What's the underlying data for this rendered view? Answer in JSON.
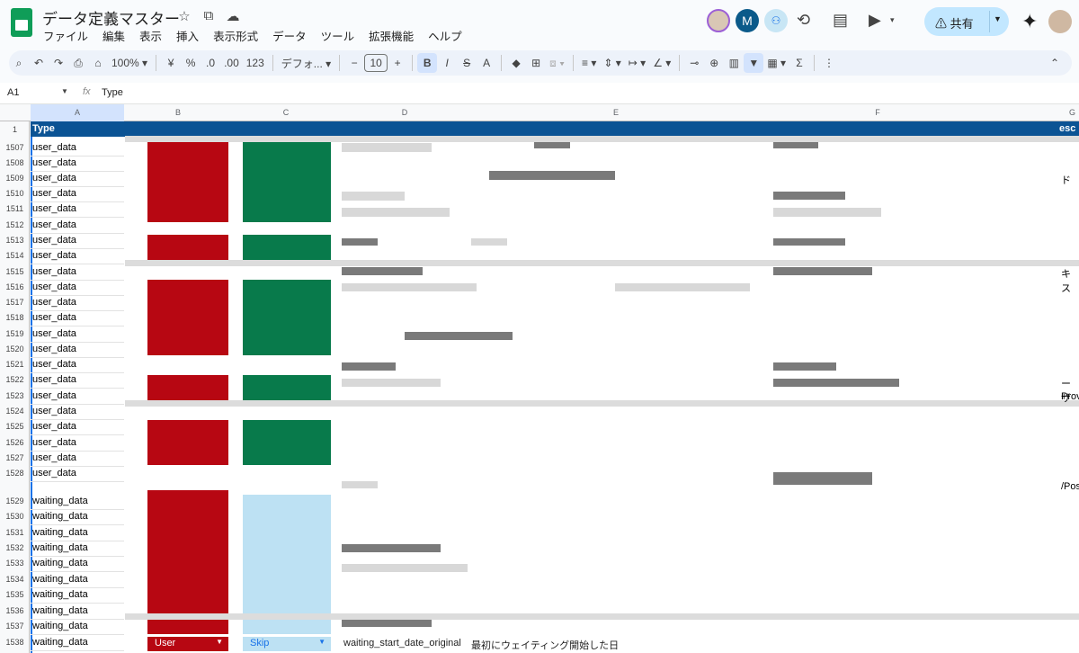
{
  "document": {
    "title": "データ定義マスター"
  },
  "menu": [
    "ファイル",
    "編集",
    "表示",
    "挿入",
    "表示形式",
    "データ",
    "ツール",
    "拡張機能",
    "ヘルプ"
  ],
  "header": {
    "share_label": "共有",
    "avatar_initial": "M"
  },
  "toolbar": {
    "zoom": "100%",
    "currency": "¥",
    "percent": "%",
    "dec_minus": ".0",
    "dec_plus": ".00",
    "number_format": "123",
    "font": "デフォ...",
    "font_size": "10",
    "bold": "B",
    "italic": "I",
    "strike": "S",
    "text_color": "A",
    "sum": "Σ"
  },
  "formula": {
    "cell": "A1",
    "fx": "fx",
    "value": "Type"
  },
  "columns": [
    "A",
    "B",
    "C",
    "D",
    "E",
    "F",
    "G"
  ],
  "sheet": {
    "header_type": "Type",
    "header_g": "esc",
    "rows": [
      {
        "num": "1507",
        "type": "user_data"
      },
      {
        "num": "1508",
        "type": "user_data"
      },
      {
        "num": "1509",
        "type": "user_data"
      },
      {
        "num": "1510",
        "type": "user_data"
      },
      {
        "num": "1511",
        "type": "user_data"
      },
      {
        "num": "1512",
        "type": "user_data"
      },
      {
        "num": "1513",
        "type": "user_data"
      },
      {
        "num": "1514",
        "type": "user_data"
      },
      {
        "num": "1515",
        "type": "user_data"
      },
      {
        "num": "1516",
        "type": "user_data"
      },
      {
        "num": "1517",
        "type": "user_data"
      },
      {
        "num": "1518",
        "type": "user_data"
      },
      {
        "num": "1519",
        "type": "user_data"
      },
      {
        "num": "1520",
        "type": "user_data"
      },
      {
        "num": "1521",
        "type": "user_data"
      },
      {
        "num": "1522",
        "type": "user_data"
      },
      {
        "num": "1523",
        "type": "user_data"
      },
      {
        "num": "1524",
        "type": "user_data"
      },
      {
        "num": "1525",
        "type": "user_data"
      },
      {
        "num": "1526",
        "type": "user_data"
      },
      {
        "num": "1527",
        "type": "user_data"
      },
      {
        "num": "1528",
        "type": "user_data"
      },
      {
        "num": "1529",
        "type": "waiting_data"
      },
      {
        "num": "1530",
        "type": "waiting_data"
      },
      {
        "num": "1531",
        "type": "waiting_data"
      },
      {
        "num": "1532",
        "type": "waiting_data"
      },
      {
        "num": "1533",
        "type": "waiting_data"
      },
      {
        "num": "1534",
        "type": "waiting_data"
      },
      {
        "num": "1535",
        "type": "waiting_data"
      },
      {
        "num": "1536",
        "type": "waiting_data"
      },
      {
        "num": "1537",
        "type": "waiting_data"
      },
      {
        "num": "1538",
        "type": "waiting_data"
      }
    ],
    "last_row": {
      "b_chip": "User",
      "c_chip": "Skip",
      "d": "waiting_start_date_original",
      "e": "最初にウェイティング開始した日"
    },
    "partials": {
      "r1509": "ド",
      "r1515": "キス",
      "r1522": "ーザ",
      "r1523": "Prov",
      "r1528": "/Pos"
    }
  },
  "colors": {
    "header_blue": "#0b5394",
    "red": "#b70712",
    "green": "#087a4b",
    "light_blue": "#bde1f3",
    "share_bg": "#c2e7ff",
    "toolbar_bg": "#edf2fa"
  }
}
